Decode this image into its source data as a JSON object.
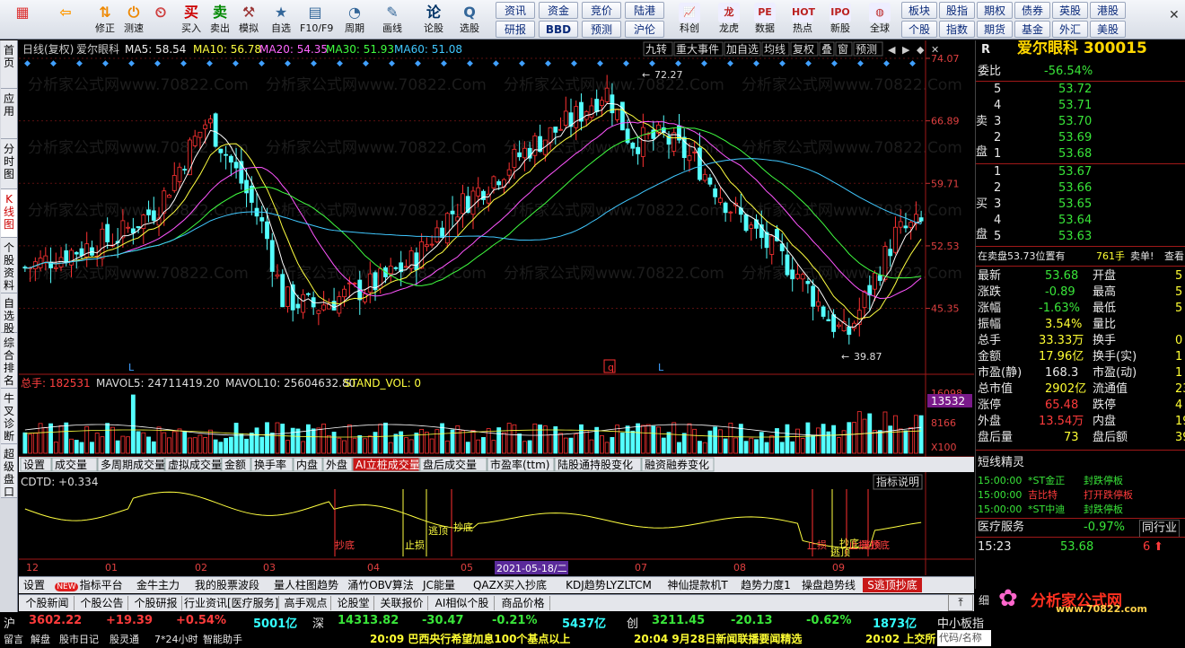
{
  "toolbar": {
    "items": [
      {
        "label": "",
        "icon": "grid-icon"
      },
      {
        "label": "",
        "icon": "back-arrow-icon"
      },
      {
        "label": "修正",
        "icon": "up-down-icon"
      },
      {
        "label": "测速",
        "icon": "speed-icon"
      },
      {
        "label": "",
        "icon": "clock-icon"
      },
      {
        "label": "买入",
        "icon": "buy-icon"
      },
      {
        "label": "卖出",
        "icon": "sell-icon"
      },
      {
        "label": "模拟",
        "icon": "hammer-icon"
      },
      {
        "label": "自选",
        "icon": "star-icon"
      },
      {
        "label": "F10/F9",
        "icon": "f10-icon"
      },
      {
        "label": "周期",
        "icon": "cycle-icon"
      },
      {
        "label": "画线",
        "icon": "pen-icon"
      },
      {
        "label": "论股",
        "icon": "discuss-icon"
      },
      {
        "label": "选股",
        "icon": "search-icon"
      }
    ],
    "top_buttons": [
      "资讯",
      "资金",
      "竞价",
      "陆港"
    ],
    "bottom_buttons": [
      "研报",
      "BBD",
      "预测",
      "沪伦"
    ],
    "icon_buttons": [
      {
        "label": "科创",
        "icon": "kc-icon"
      },
      {
        "label": "龙虎",
        "icon": "dragon-icon"
      },
      {
        "label": "数据",
        "icon": "pe-icon"
      },
      {
        "label": "热点",
        "icon": "hot-icon"
      },
      {
        "label": "新股",
        "icon": "ipo-icon"
      },
      {
        "label": "全球",
        "icon": "globe-icon"
      }
    ],
    "right_grid": [
      [
        "板块",
        "股指",
        "期权",
        "债券",
        "英股",
        "港股"
      ],
      [
        "个股",
        "指数",
        "期货",
        "基金",
        "外汇",
        "美股"
      ]
    ]
  },
  "leftnav": [
    "首页",
    "应用",
    "分时图",
    "K线图",
    "个股资料",
    "自选股",
    "综合排名",
    "牛叉诊断",
    "超级盘口"
  ],
  "chart": {
    "header": {
      "mode": "日线(复权)",
      "name": "爱尔眼科",
      "ma5": "MA5: 58.54",
      "ma10": "MA10: 56.78",
      "ma20": "MA20: 54.35",
      "ma30": "MA30: 51.93",
      "ma60": "MA60: 51.08"
    },
    "header_buttons": [
      "九转",
      "重大事件",
      "加自选",
      "均线",
      "复权",
      "叠",
      "窗",
      "预测"
    ],
    "price_axis": [
      "74.07",
      "66.89",
      "59.71",
      "52.53",
      "45.35"
    ],
    "high_label": "72.27",
    "low_label": "39.87",
    "vol_header": {
      "total": "总手: 182531",
      "mavol5": "MAVOL5: 24711419.20",
      "mavol10": "MAVOL10: 25604632.80",
      "stand": "STAND_VOL: 0"
    },
    "vol_axis": [
      "16098",
      "8166",
      "X100"
    ],
    "vol_badge": "13532",
    "ind_tabs": [
      "设置",
      "成交量",
      "多周期成交量",
      "虚拟成交量",
      "金额",
      "换手率",
      "内盘",
      "外盘",
      "AI立桩成交量",
      "盘后成交量",
      "市盈率(ttm)",
      "陆股通持股变化",
      "融资融券变化"
    ],
    "cdtd": "CDTD: +0.334",
    "ind_btn": "指标说明",
    "signals": [
      "抄底",
      "止损",
      "逃顶",
      "抄底",
      "止损",
      "逃顶",
      "抄底",
      "止损",
      "逃顶",
      "抄底"
    ],
    "x_labels": [
      "12",
      "01",
      "02",
      "03",
      "04",
      "05",
      "06",
      "07",
      "08",
      "09"
    ],
    "date_badge": "2021-05-18/二",
    "markers": [
      "L",
      "q",
      "L"
    ]
  },
  "bottom_tabs1": [
    "设置",
    "指标平台",
    "金牛主力",
    "我的股票波段",
    "量人柱图趋势",
    "涌竹OBV算法",
    "JC能量",
    "QAZX买入抄底",
    "KDJ趋势LYZLTCM",
    "神仙提款机T",
    "趋势力度1",
    "操盘趋势线",
    "S逃顶抄底"
  ],
  "new_badge": "NEW",
  "bottom_tabs2": [
    "个股新闻",
    "个股公告",
    "个股研报",
    "行业资讯[医疗服务]",
    "高手观点",
    "论股堂",
    "关联报价",
    "AI相似个股",
    "商品价格"
  ],
  "right": {
    "code_title": "爱尔眼科 300015",
    "r_tag": "R",
    "weibi_label": "委比",
    "weibi": "-56.54%",
    "sell_label": "卖盘",
    "buy_label": "买盘",
    "sell": [
      [
        "5",
        "53.72"
      ],
      [
        "4",
        "53.71"
      ],
      [
        "3",
        "53.70"
      ],
      [
        "2",
        "53.69"
      ],
      [
        "1",
        "53.68"
      ]
    ],
    "buy": [
      [
        "1",
        "53.67"
      ],
      [
        "2",
        "53.66"
      ],
      [
        "3",
        "53.65"
      ],
      [
        "4",
        "53.64"
      ],
      [
        "5",
        "53.63"
      ]
    ],
    "zaimai": "在卖盘53.73位置有",
    "zaimai_qty": "761手",
    "zaimai_tag": "卖单!",
    "zaimai_btn": "查看",
    "quotes": [
      [
        "最新",
        "53.68",
        "开盘",
        "5"
      ],
      [
        "涨跌",
        "-0.89",
        "最高",
        "5"
      ],
      [
        "涨幅",
        "-1.63%",
        "最低",
        "5"
      ],
      [
        "振幅",
        "3.54%",
        "量比",
        ""
      ],
      [
        "总手",
        "33.33万",
        "换手",
        "0"
      ],
      [
        "金额",
        "17.96亿",
        "换手(实)",
        "1"
      ],
      [
        "市盈(静)",
        "168.3",
        "市盈(动)",
        "1"
      ],
      [
        "总市值",
        "2902亿",
        "流通值",
        "23"
      ],
      [
        "涨停",
        "65.48",
        "跌停",
        "4"
      ],
      [
        "外盘",
        "13.54万",
        "内盘",
        "19."
      ],
      [
        "盘后量",
        "73",
        "盘后额",
        "39."
      ]
    ],
    "short_title": "短线精灵",
    "short_list": [
      [
        "15:00:00",
        "*ST金正",
        "封跌停板"
      ],
      [
        "15:00:00",
        "吉比特",
        "打开跌停板"
      ],
      [
        "15:00:00",
        "*ST中迪",
        "封跌停板"
      ]
    ],
    "sector": "医疗服务",
    "sector_chg": "-0.97%",
    "sector_btn": "同行业",
    "tick_time": "15:23",
    "tick_price": "53.68",
    "tick_vol": "6"
  },
  "status": {
    "sh": {
      "label": "沪",
      "value": "3602.22",
      "chg": "+19.39",
      "pct": "+0.54%",
      "amt": "5001亿"
    },
    "sz": {
      "label": "深",
      "value": "14313.82",
      "chg": "-30.47",
      "pct": "-0.21%",
      "amt": "5437亿"
    },
    "cy": {
      "label": "创",
      "value": "3211.45",
      "chg": "-20.13",
      "pct": "-0.62%",
      "amt": "1873亿"
    },
    "extra": "中小板指",
    "row2": [
      "留言",
      "解盘",
      "股市日记",
      "股灵通",
      "7*24小时",
      "智能助手"
    ],
    "news1": "20:09 巴西央行希望加息100个基点以上",
    "news2": "20:04 9月28日新闻联播要闻精选",
    "news3": "20:02 上交所",
    "search": "代码/名称"
  },
  "logo": {
    "title": "分析家公式网",
    "url": "www.70822.com"
  },
  "watermark": "分析家公式网www.70822.Com"
}
